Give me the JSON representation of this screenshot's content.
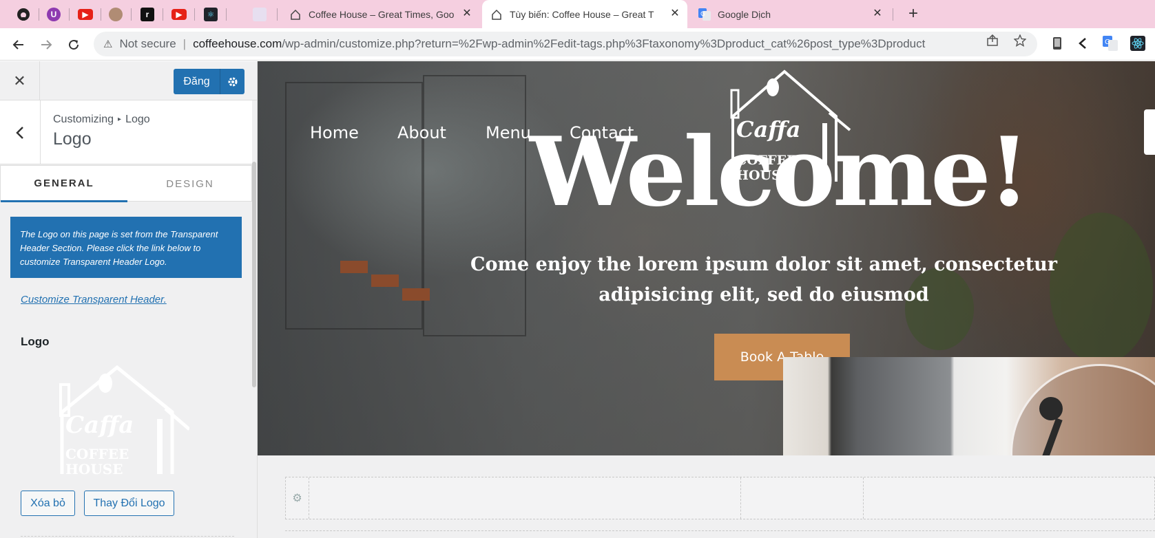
{
  "browser": {
    "tabs": [
      {
        "title": "Coffee House – Great Times, Goo",
        "close": "✕"
      },
      {
        "title": "Tùy biến: Coffee House – Great T",
        "close": "✕"
      },
      {
        "title": "Google Dịch",
        "close": "✕"
      }
    ],
    "new_tab": "+",
    "address": {
      "warning": "⚠",
      "security": "Not secure",
      "separator": "|",
      "host": "coffeehouse.com",
      "path": "/wp-admin/customize.php?return=%2Fwp-admin%2Fedit-tags.php%3Ftaxonomy%3Dproduct_cat%26post_type%3Dproduct"
    }
  },
  "customizer": {
    "close": "✕",
    "publish_label": "Đăng",
    "back": "‹",
    "breadcrumb": {
      "root": "Customizing",
      "arrow": "▸",
      "current": "Logo"
    },
    "section_title": "Logo",
    "tabs": {
      "general": "GENERAL",
      "design": "DESIGN"
    },
    "notice": "The Logo on this page is set from the Transparent Header Section. Please click the link below to customize Transparent Header Logo.",
    "link": "Customize Transparent Header.",
    "logo_label": "Logo",
    "logo_script": "Caffa",
    "logo_line1": "COFFEE",
    "logo_line2": "HOUSE",
    "remove_button": "Xóa bỏ",
    "change_button": "Thay Đổi Logo"
  },
  "preview": {
    "nav": [
      "Home",
      "About",
      "Menu",
      "Contact"
    ],
    "logo_script": "Caffa",
    "logo_line1": "COFFEE",
    "logo_line2": "HOUSE",
    "headline": "Welcome!",
    "subtitle": "Come enjoy the lorem ipsum dolor sit amet, consectetur adipisicing elit, sed do eiusmod",
    "cta": "Book A Table"
  },
  "colors": {
    "tabstrip": "#f5cfe0",
    "wp_blue": "#2271b1",
    "cta": "#c98c53"
  }
}
